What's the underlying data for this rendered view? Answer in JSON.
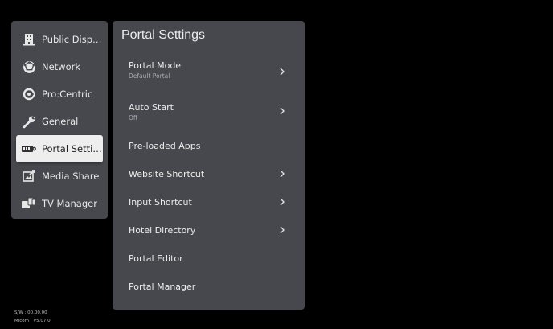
{
  "sidebar": {
    "items": [
      {
        "label": "Public Display...",
        "icon": "building-icon",
        "selected": false
      },
      {
        "label": "Network",
        "icon": "network-globe-icon",
        "selected": false
      },
      {
        "label": "Pro:Centric",
        "icon": "procentric-icon",
        "selected": false
      },
      {
        "label": "General",
        "icon": "wrench-icon",
        "selected": false
      },
      {
        "label": "Portal Settings",
        "icon": "portal-settings-icon",
        "selected": true
      },
      {
        "label": "Media Share",
        "icon": "media-share-icon",
        "selected": false
      },
      {
        "label": "TV Manager",
        "icon": "tv-manager-icon",
        "selected": false
      }
    ]
  },
  "panel": {
    "title": "Portal Settings",
    "rows": [
      {
        "label": "Portal Mode",
        "sub": "Default Portal",
        "chevron": true
      },
      {
        "label": "Auto Start",
        "sub": "Off",
        "chevron": true
      },
      {
        "label": "Pre-loaded Apps",
        "sub": "",
        "chevron": false
      },
      {
        "label": "Website Shortcut",
        "sub": "",
        "chevron": true
      },
      {
        "label": "Input Shortcut",
        "sub": "",
        "chevron": true
      },
      {
        "label": "Hotel Directory",
        "sub": "",
        "chevron": true
      },
      {
        "label": "Portal Editor",
        "sub": "",
        "chevron": false
      },
      {
        "label": "Portal Manager",
        "sub": "",
        "chevron": false
      }
    ]
  },
  "footer": {
    "sw": "S/W : 00.00.00",
    "micom": "Micom : V5.07.0"
  },
  "colors": {
    "background": "#000000",
    "panel": "#46484d",
    "selected": "#eeeeee",
    "text": "#ececec",
    "subtext": "#a9abb0"
  }
}
